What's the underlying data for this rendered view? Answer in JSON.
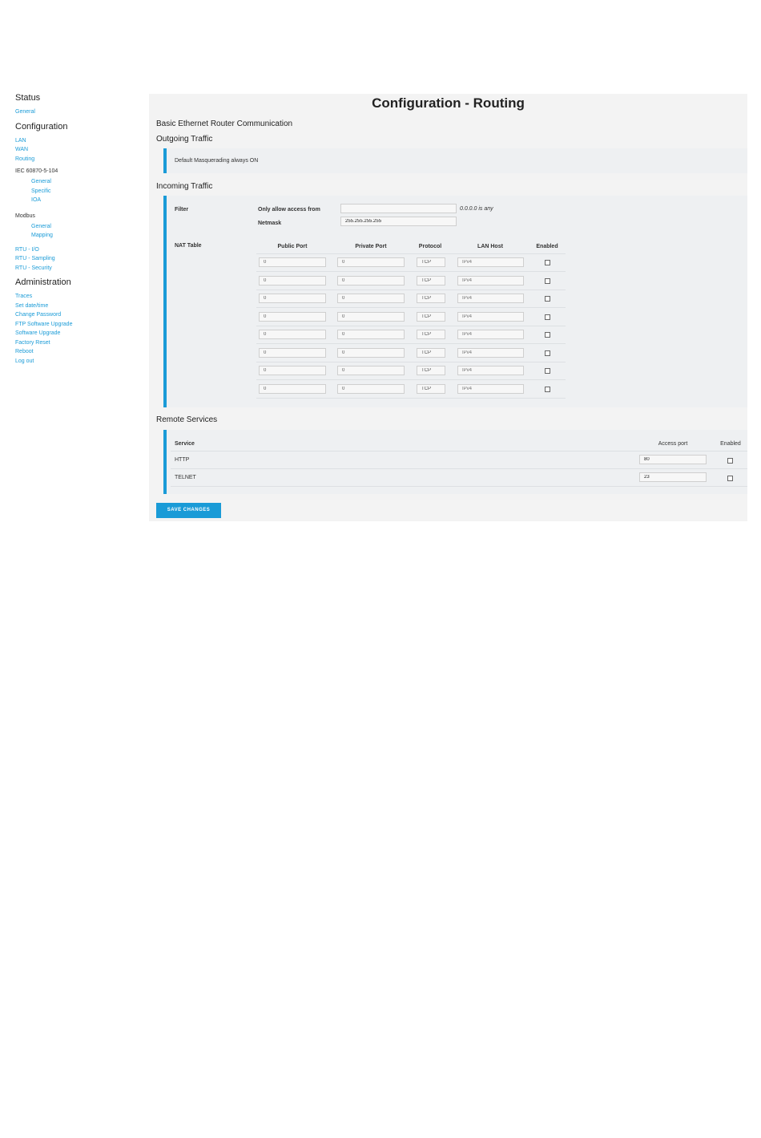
{
  "sidebar": {
    "status_heading": "Status",
    "status_links": [
      "General"
    ],
    "config_heading": "Configuration",
    "config_links": [
      "LAN",
      "WAN",
      "Routing"
    ],
    "iec_heading": "IEC 60870-5-104",
    "iec_links": [
      "General",
      "Specific",
      "IOA"
    ],
    "modbus_heading": "Modbus",
    "modbus_links": [
      "General",
      "Mapping"
    ],
    "rtu_links": [
      "RTU - I/O",
      "RTU - Sampling",
      "RTU - Security"
    ],
    "admin_heading": "Administration",
    "admin_links": [
      "Traces",
      "Set date/time",
      "Change Password",
      "FTP Software Upgrade",
      "Software Upgrade",
      "Factory Reset",
      "Reboot",
      "Log out"
    ]
  },
  "main": {
    "title": "Configuration - Routing",
    "section_basic": "Basic Ethernet Router Communication",
    "section_outgoing": "Outgoing Traffic",
    "outgoing_note": "Default Masquerading always ON",
    "section_incoming": "Incoming Traffic",
    "filter": {
      "label": "Filter",
      "access_label": "Only allow access from",
      "access_value": "",
      "access_hint": "0.0.0.0 is any",
      "netmask_label": "Netmask",
      "netmask_value": "255.255.255.255"
    },
    "nat": {
      "label": "NAT Table",
      "columns": [
        "Public Port",
        "Private Port",
        "Protocol",
        "LAN Host",
        "Enabled"
      ],
      "rows": [
        {
          "public": "0",
          "private": "0",
          "protocol": "TCP",
          "host_placeholder": "IPv4"
        },
        {
          "public": "0",
          "private": "0",
          "protocol": "TCP",
          "host_placeholder": "IPv4"
        },
        {
          "public": "0",
          "private": "0",
          "protocol": "TCP",
          "host_placeholder": "IPv4"
        },
        {
          "public": "0",
          "private": "0",
          "protocol": "TCP",
          "host_placeholder": "IPv4"
        },
        {
          "public": "0",
          "private": "0",
          "protocol": "TCP",
          "host_placeholder": "IPv4"
        },
        {
          "public": "0",
          "private": "0",
          "protocol": "TCP",
          "host_placeholder": "IPv4"
        },
        {
          "public": "0",
          "private": "0",
          "protocol": "TCP",
          "host_placeholder": "IPv4"
        },
        {
          "public": "0",
          "private": "0",
          "protocol": "TCP",
          "host_placeholder": "IPv4"
        }
      ]
    },
    "section_remote": "Remote Services",
    "remote": {
      "columns": [
        "Service",
        "Access port",
        "Enabled"
      ],
      "rows": [
        {
          "service": "HTTP",
          "port": "80"
        },
        {
          "service": "TELNET",
          "port": "23"
        }
      ]
    },
    "save_label": "SAVE CHANGES"
  },
  "colors": {
    "accent": "#1a9bd7",
    "panel": "#f3f3f3"
  }
}
